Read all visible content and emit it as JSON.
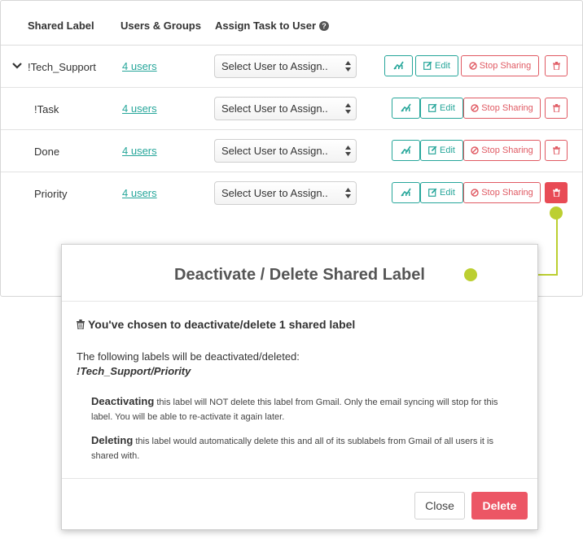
{
  "table": {
    "headers": {
      "shared_label": "Shared Label",
      "users_groups": "Users & Groups",
      "assign_task": "Assign Task to User"
    },
    "rows": [
      {
        "label": "!Tech_Support",
        "users": "4 users",
        "select_value": "Select User to Assign..",
        "edit": "Edit",
        "stop": "Stop Sharing"
      },
      {
        "label": "!Task",
        "users": "4 users",
        "select_value": "Select User to Assign..",
        "edit": "Edit",
        "stop": "Stop Sharing"
      },
      {
        "label": "Done",
        "users": "4 users",
        "select_value": "Select User to Assign..",
        "edit": "Edit",
        "stop": "Stop Sharing"
      },
      {
        "label": "Priority",
        "users": "4 users",
        "select_value": "Select User to Assign..",
        "edit": "Edit",
        "stop": "Stop Sharing"
      }
    ]
  },
  "modal": {
    "title": "Deactivate / Delete Shared Label",
    "subtitle": "You've chosen to deactivate/delete 1 shared label",
    "lead": "The following labels will be deactivated/deleted:",
    "label_path": "!Tech_Support/Priority",
    "deactivating_term": "Deactivating",
    "deactivating_text": " this label will NOT delete this label from Gmail. Only the email syncing will stop for this label. You will be able to re-activate it again later.",
    "deleting_term": "Deleting",
    "deleting_text": " this label would automatically delete this and all of its sublabels from Gmail of all users it is shared with.",
    "close_label": "Close",
    "delete_label": "Delete"
  },
  "colors": {
    "accent_teal": "#26a69a",
    "danger": "#e84b55",
    "callout": "#bccf31"
  },
  "icons": [
    "chevron-down-icon",
    "question-circle-icon",
    "chart-icon",
    "edit-icon",
    "ban-icon",
    "trash-icon"
  ]
}
